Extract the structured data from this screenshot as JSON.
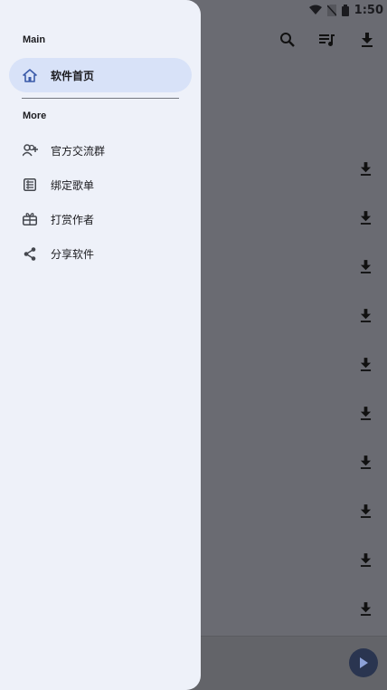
{
  "status_bar": {
    "time": "1:50",
    "icons": [
      "wifi-icon",
      "no-sim-icon",
      "battery-icon"
    ]
  },
  "app_bar": {
    "actions": [
      "search-icon",
      "playlist-icon",
      "download-icon"
    ]
  },
  "song_list": {
    "row_action_icon": "download-icon",
    "row_count": 10
  },
  "drawer": {
    "main_title": "Main",
    "main_items": [
      {
        "label": "软件首页",
        "icon": "home-icon",
        "active": true
      }
    ],
    "more_title": "More",
    "more_items": [
      {
        "label": "官方交流群",
        "icon": "group-add-icon"
      },
      {
        "label": "绑定歌单",
        "icon": "list-icon"
      },
      {
        "label": "打赏作者",
        "icon": "gift-icon"
      },
      {
        "label": "分享软件",
        "icon": "share-icon"
      }
    ]
  },
  "colors": {
    "drawer_bg": "#eef1f9",
    "active_item_bg": "#d8e2f8",
    "scrim": "#6a6b72",
    "accent": "#3b5ba9"
  }
}
